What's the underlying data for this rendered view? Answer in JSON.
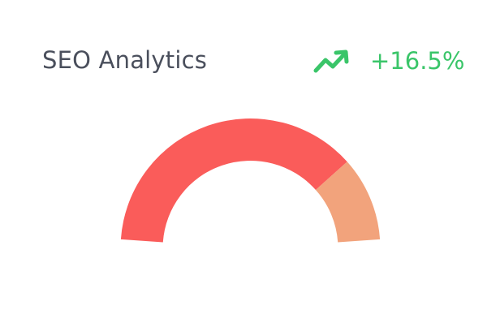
{
  "card": {
    "title": "SEO Analytics",
    "trend": {
      "icon": "trending-up-icon",
      "value": "+16.5%",
      "color": "#3ac569"
    }
  },
  "gauge": {
    "total": 100,
    "segments": [
      {
        "value": 78,
        "color": "#fa5c5a"
      },
      {
        "value": 22,
        "color": "#f2a37c"
      }
    ]
  }
}
